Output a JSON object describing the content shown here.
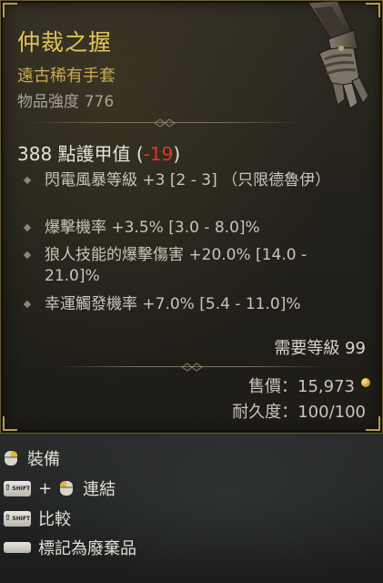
{
  "item": {
    "name": "仲裁之握",
    "rarity": "遠古稀有手套",
    "power_label": "物品強度",
    "power_value": "776",
    "armor_text": "388 點護甲值",
    "armor_delta": "-19",
    "affixes": [
      {
        "text": "閃電風暴等級 +3 [2 - 3] （只限德魯伊）"
      },
      {
        "text": "爆擊機率 +3.5% [3.0 - 8.0]%"
      },
      {
        "text": "狼人技能的爆擊傷害 +20.0% [14.0 - 21.0]%"
      },
      {
        "text": "幸運觸發機率 +7.0% [5.4 - 11.0]%"
      }
    ],
    "required_level": "需要等級 99",
    "sell_value": "售價：15,973",
    "durability": "耐久度：100/100"
  },
  "actions": {
    "equip": "裝備",
    "link_plus": "+",
    "link": "連結",
    "compare": "比較",
    "mark_junk": "標記為廢棄品",
    "shift_label": "SHIFT"
  },
  "colors": {
    "title": "#e0c35a",
    "rarity": "#c9ab4f",
    "negative": "#d63a2a"
  },
  "icons": [
    "gauntlet-icon",
    "mouse-left-icon",
    "shift-key-icon",
    "mouse-right-icon",
    "space-key-icon",
    "gold-coin-icon"
  ]
}
